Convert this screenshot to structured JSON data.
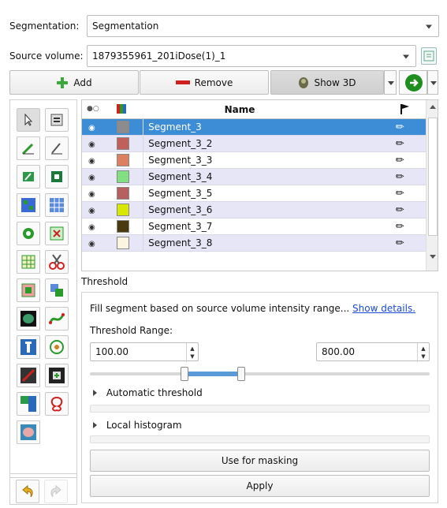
{
  "segmentation": {
    "label": "Segmentation:",
    "value": "Segmentation"
  },
  "source_volume": {
    "label": "Source volume:",
    "value": "1879355961_201iDose(1)_1"
  },
  "toolbar": {
    "add_label": "Add",
    "remove_label": "Remove",
    "show3d_label": "Show 3D"
  },
  "table": {
    "header_name": "Name",
    "rows": [
      {
        "name": "Segment_3",
        "color": "#8c8c8c",
        "selected": true
      },
      {
        "name": "Segment_3_2",
        "color": "#c0605a"
      },
      {
        "name": "Segment_3_3",
        "color": "#dd8060"
      },
      {
        "name": "Segment_3_4",
        "color": "#80e080"
      },
      {
        "name": "Segment_3_5",
        "color": "#b86060"
      },
      {
        "name": "Segment_3_6",
        "color": "#d8e800"
      },
      {
        "name": "Segment_3_7",
        "color": "#4a3a10"
      },
      {
        "name": "Segment_3_8",
        "color": "#fbf5e0"
      }
    ]
  },
  "threshold": {
    "section_title": "Threshold",
    "description": "Fill segment based on source volume intensity range...",
    "details_link": "Show details.",
    "range_label": "Threshold Range:",
    "min_value": "100.00",
    "max_value": "800.00",
    "auto_label": "Automatic threshold",
    "hist_label": "Local histogram",
    "masking_label": "Use for masking",
    "apply_label": "Apply"
  },
  "colors": {
    "accent": "#3d8dd6",
    "slider": "#5a9ad8"
  }
}
